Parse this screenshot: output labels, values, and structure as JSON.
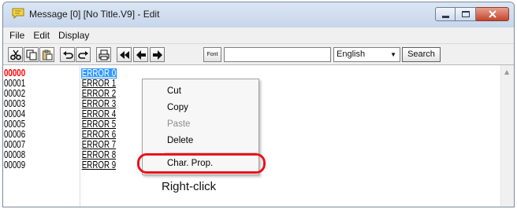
{
  "window": {
    "title": "Message [0] [No Title.V9] - Edit",
    "icon": "speech-bubble-icon"
  },
  "menubar": {
    "items": [
      "File",
      "Edit",
      "Display"
    ]
  },
  "toolbar": {
    "buttons": [
      "cut-icon",
      "copy-icon",
      "paste-icon",
      "undo-icon",
      "redo-icon",
      "print-icon",
      "first-icon",
      "prev-icon",
      "next-icon"
    ],
    "font_label": "Font",
    "search_value": "",
    "language_value": "English",
    "search_button_label": "Search"
  },
  "editor": {
    "rows": [
      {
        "no": "00000",
        "text": "ERROR 0"
      },
      {
        "no": "00001",
        "text": "ERROR 1"
      },
      {
        "no": "00002",
        "text": "ERROR 2"
      },
      {
        "no": "00003",
        "text": "ERROR 3"
      },
      {
        "no": "00004",
        "text": "ERROR 4"
      },
      {
        "no": "00005",
        "text": "ERROR 5"
      },
      {
        "no": "00006",
        "text": "ERROR 6"
      },
      {
        "no": "00007",
        "text": "ERROR 7"
      },
      {
        "no": "00008",
        "text": "ERROR 8"
      },
      {
        "no": "00009",
        "text": "ERROR 9"
      }
    ],
    "active_row_color": "#ff0000",
    "selection_color": "#3399ff"
  },
  "context_menu": {
    "items": [
      {
        "label": "Cut",
        "enabled": true
      },
      {
        "label": "Copy",
        "enabled": true
      },
      {
        "label": "Paste",
        "enabled": false
      },
      {
        "label": "Delete",
        "enabled": true
      },
      {
        "label": "Char. Prop.",
        "enabled": true
      }
    ]
  },
  "annotation": {
    "label": "Right-click",
    "highlight_color": "#e8141c"
  }
}
